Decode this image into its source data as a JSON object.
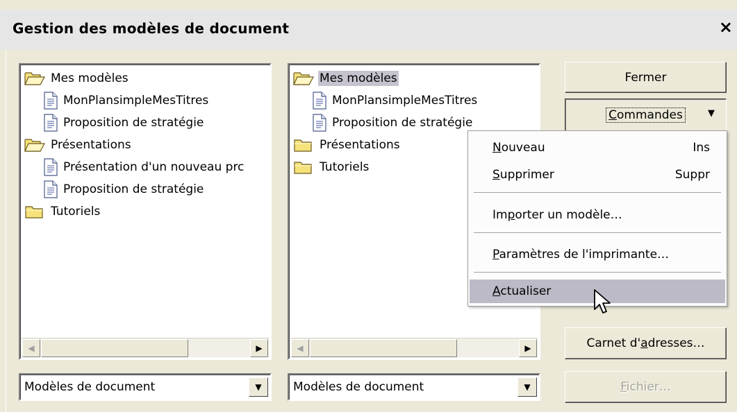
{
  "window": {
    "title": "Gestion des modèles de document",
    "close": "×"
  },
  "left_panel": {
    "items": [
      {
        "label": "Mes modèles",
        "type": "folder-open"
      },
      {
        "label": "MonPlansimpleMesTitres",
        "type": "doc"
      },
      {
        "label": "Proposition de stratégie",
        "type": "doc"
      },
      {
        "label": "Présentations",
        "type": "folder-open"
      },
      {
        "label": "Présentation d'un nouveau prc",
        "type": "doc"
      },
      {
        "label": "Proposition de stratégie",
        "type": "doc"
      },
      {
        "label": "Tutoriels",
        "type": "folder"
      }
    ],
    "dropdown_value": "Modèles de document"
  },
  "right_panel": {
    "items": [
      {
        "label": "Mes modèles",
        "type": "folder-open",
        "selected": true
      },
      {
        "label": "MonPlansimpleMesTitres",
        "type": "doc"
      },
      {
        "label": "Proposition de stratégie",
        "type": "doc"
      },
      {
        "label": "Présentations",
        "type": "folder"
      },
      {
        "label": "Tutoriels",
        "type": "folder"
      }
    ],
    "dropdown_value": "Modèles de document"
  },
  "buttons": {
    "fermer": "Fermer",
    "commandes_pre": "",
    "commandes_u": "C",
    "commandes_post": "ommandes",
    "carnet_pre": "Carnet d'",
    "carnet_u": "a",
    "carnet_post": "dresses…",
    "fichier_u": "F",
    "fichier_post": "ichier…"
  },
  "menu": {
    "nouveau_u": "N",
    "nouveau_post": "ouveau",
    "nouveau_sc": "Ins",
    "supprimer_u": "S",
    "supprimer_post": "upprimer",
    "supprimer_sc": "Suppr",
    "importer_pre": "Im",
    "importer_u": "p",
    "importer_post": "orter un modèle…",
    "parametres_u": "P",
    "parametres_post": "aramètres de l'imprimante…",
    "actualiser_u": "A",
    "actualiser_post": "ctualiser"
  },
  "colors": {
    "selection": "#c6c3cf",
    "menu_highlight": "#bcbac6",
    "folder": "#f5e27a"
  }
}
